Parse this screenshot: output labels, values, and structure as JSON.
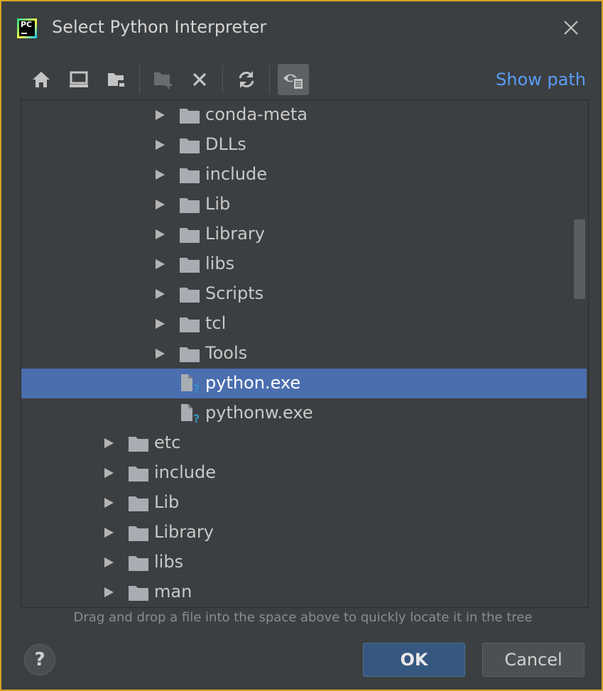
{
  "window": {
    "title": "Select Python Interpreter",
    "app_icon": "pycharm-logo",
    "app_icon_text": "PC"
  },
  "toolbar": {
    "buttons": [
      {
        "name": "home",
        "icon": "home-icon"
      },
      {
        "name": "desktop",
        "icon": "desktop-icon"
      },
      {
        "name": "project",
        "icon": "project-folder-icon"
      },
      {
        "name": "new-folder",
        "icon": "new-folder-icon",
        "enabled": false
      },
      {
        "name": "delete",
        "icon": "delete-icon"
      },
      {
        "name": "refresh",
        "icon": "refresh-icon"
      },
      {
        "name": "show-hidden",
        "icon": "show-hidden-icon",
        "active": true
      }
    ],
    "show_path_label": "Show path"
  },
  "tree": {
    "rows": [
      {
        "label": "conda-meta",
        "type": "folder",
        "level": 2,
        "expandable": true
      },
      {
        "label": "DLLs",
        "type": "folder",
        "level": 2,
        "expandable": true
      },
      {
        "label": "include",
        "type": "folder",
        "level": 2,
        "expandable": true
      },
      {
        "label": "Lib",
        "type": "folder",
        "level": 2,
        "expandable": true
      },
      {
        "label": "Library",
        "type": "folder",
        "level": 2,
        "expandable": true
      },
      {
        "label": "libs",
        "type": "folder",
        "level": 2,
        "expandable": true
      },
      {
        "label": "Scripts",
        "type": "folder",
        "level": 2,
        "expandable": true
      },
      {
        "label": "tcl",
        "type": "folder",
        "level": 2,
        "expandable": true
      },
      {
        "label": "Tools",
        "type": "folder",
        "level": 2,
        "expandable": true
      },
      {
        "label": "python.exe",
        "type": "file",
        "level": 2,
        "expandable": false,
        "selected": true
      },
      {
        "label": "pythonw.exe",
        "type": "file",
        "level": 2,
        "expandable": false
      },
      {
        "label": "etc",
        "type": "folder",
        "level": 1,
        "expandable": true
      },
      {
        "label": "include",
        "type": "folder",
        "level": 1,
        "expandable": true
      },
      {
        "label": "Lib",
        "type": "folder",
        "level": 1,
        "expandable": true
      },
      {
        "label": "Library",
        "type": "folder",
        "level": 1,
        "expandable": true
      },
      {
        "label": "libs",
        "type": "folder",
        "level": 1,
        "expandable": true
      },
      {
        "label": "man",
        "type": "folder",
        "level": 1,
        "expandable": true
      }
    ]
  },
  "hint": "Drag and drop a file into the space above to quickly locate it in the tree",
  "buttons": {
    "help": "?",
    "ok": "OK",
    "cancel": "Cancel"
  },
  "colors": {
    "background": "#3c3f41",
    "selection": "#4b6eaf",
    "link": "#589df6",
    "ok_button": "#365880",
    "window_border": "#d8a51e"
  }
}
